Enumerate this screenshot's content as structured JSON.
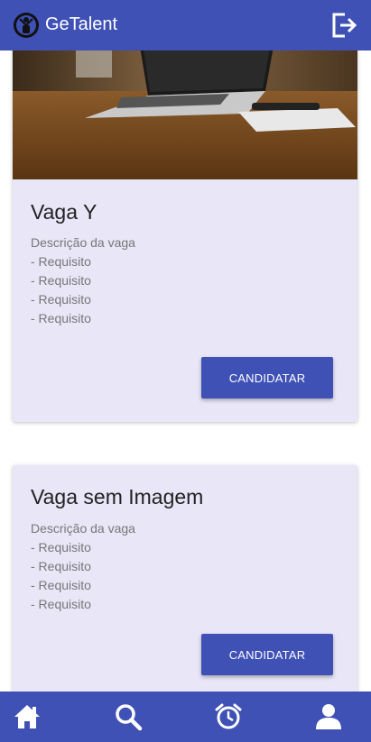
{
  "header": {
    "title": "GeTalent"
  },
  "jobs": [
    {
      "title": "Vaga Y",
      "description": "Descrição da vaga",
      "requirements": [
        "- Requisito",
        "- Requisito",
        "- Requisito",
        "- Requisito"
      ],
      "button_label": "CANDIDATAR"
    },
    {
      "title": "Vaga sem Imagem",
      "description": "Descrição da vaga",
      "requirements": [
        "- Requisito",
        "- Requisito",
        "- Requisito",
        "- Requisito"
      ],
      "button_label": "CANDIDATAR"
    }
  ],
  "nav": [
    "home-icon",
    "search-icon",
    "alarm-clock-icon",
    "user-icon"
  ],
  "colors": {
    "primary": "#3f51b5",
    "card_bg": "#e8e6f7"
  }
}
